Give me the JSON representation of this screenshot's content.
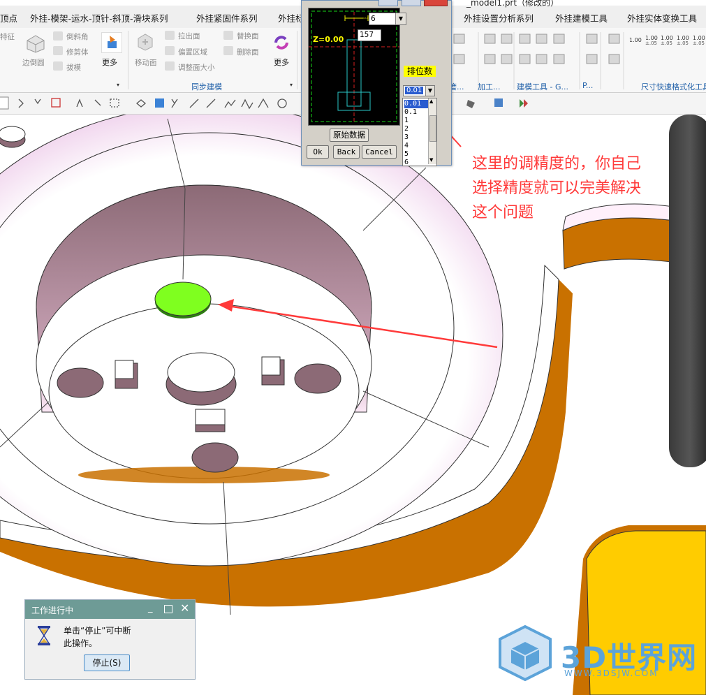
{
  "ribbon": {
    "tabs": [
      "顶点",
      "外挂-模架-运水-顶针-斜顶-滑块系列",
      "外挂紧固件系列",
      "外挂标",
      "外挂设置分析系列",
      "外挂建模工具",
      "外挂实体变换工具"
    ],
    "left_group": {
      "features": [
        "特征"
      ],
      "edge_blend": "边倒圆",
      "chamfer": "倒斜角",
      "trim_body": "修剪体",
      "draft": "拔模",
      "more": "更多"
    },
    "sync_group": {
      "move_face": "移动面",
      "pull_face": "拉出面",
      "offset_region": "偏置区域",
      "resize_face": "调整面大小",
      "replace_face": "替换面",
      "delete_face": "删除面",
      "more": "更多",
      "group_label": "同步建模"
    },
    "right_group_labels": [
      "箬...",
      "加工...",
      "建模工具 - G...",
      "P...",
      "尺寸快速格式化工具"
    ],
    "dim_values": [
      "1.00",
      "1.00",
      "1.00",
      "1.00",
      "1.00"
    ],
    "dim_sub": [
      "±.05",
      "±.05",
      "±.05",
      "±.05"
    ]
  },
  "window_title": "_model1.prt（修改的）",
  "dialog": {
    "phi_label": "ø",
    "digits_value": "6",
    "dimension_value": "157",
    "z_label": "Z=0.00",
    "sort_label": "排位数",
    "precision_selected": "0.01",
    "precision_options": [
      "0.01",
      "0.1",
      "1",
      "2",
      "3",
      "4",
      "5",
      "6"
    ],
    "original_data_button": "原始数据",
    "ok_button": "Ok",
    "back_button": "Back",
    "cancel_button": "Cancel"
  },
  "annotation": {
    "lines": [
      "这里的调精度的，你自己",
      "选择精度就可以完美解决",
      "这个问题"
    ],
    "color": "#ff3a3a"
  },
  "progress_dialog": {
    "title": "工作进行中",
    "message_line1": "单击“停止”可中断",
    "message_line2": "此操作。",
    "stop_button": "停止(S)"
  },
  "watermark": {
    "text": "3D世界网",
    "url": "WWW.3DSJW.COM"
  },
  "colors": {
    "highlight_face": "#7fff1f",
    "model_face": "#8c6a76",
    "model_edge_orange": "#c97100",
    "yellow_part": "#ffcc00",
    "accent_yellow": "#ffff00"
  }
}
